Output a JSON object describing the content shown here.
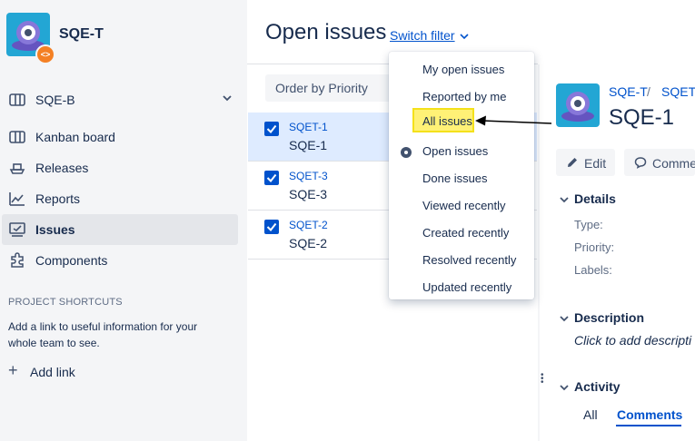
{
  "sidebar": {
    "project_name": "SQE-T",
    "board_selector": "SQE-B",
    "items": [
      {
        "label": "Kanban board",
        "icon": "board-icon"
      },
      {
        "label": "Releases",
        "icon": "ship-icon"
      },
      {
        "label": "Reports",
        "icon": "chart-icon"
      },
      {
        "label": "Issues",
        "icon": "issues-icon",
        "active": true
      },
      {
        "label": "Components",
        "icon": "puzzle-icon"
      }
    ],
    "shortcuts_title": "PROJECT SHORTCUTS",
    "shortcuts_desc": "Add a link to useful information for your whole team to see.",
    "add_link": "Add link"
  },
  "header": {
    "title": "Open issues",
    "switch_filter": "Switch filter"
  },
  "list": {
    "order_by": "Order by Priority",
    "issues": [
      {
        "key": "SQET-1",
        "summary": "SQE-1",
        "selected": true
      },
      {
        "key": "SQET-3",
        "summary": "SQE-3",
        "selected": false
      },
      {
        "key": "SQET-2",
        "summary": "SQE-2",
        "selected": false
      }
    ]
  },
  "filter_menu": {
    "items": [
      {
        "label": "My open issues"
      },
      {
        "label": "Reported by me"
      },
      {
        "label": "All issues",
        "highlighted": true
      },
      {
        "label": "Open issues",
        "checked": true
      },
      {
        "label": "Done issues"
      },
      {
        "label": "Viewed recently"
      },
      {
        "label": "Created recently"
      },
      {
        "label": "Resolved recently"
      },
      {
        "label": "Updated recently"
      }
    ]
  },
  "detail": {
    "breadcrumb_project": "SQE-T",
    "breadcrumb_sep": "/",
    "breadcrumb_issue": "SQET-",
    "issue_title": "SQE-1",
    "edit_label": "Edit",
    "comment_label": "Comme",
    "details_heading": "Details",
    "fields": {
      "type": "Type:",
      "priority": "Priority:",
      "labels": "Labels:"
    },
    "description_heading": "Description",
    "description_placeholder": "Click to add descripti",
    "activity_heading": "Activity",
    "tab_all": "All",
    "tab_comments": "Comments"
  },
  "colors": {
    "accent": "#0052cc",
    "highlight": "#fff176",
    "selected_row": "#deebff",
    "sidebar_bg": "#f4f5f7"
  }
}
